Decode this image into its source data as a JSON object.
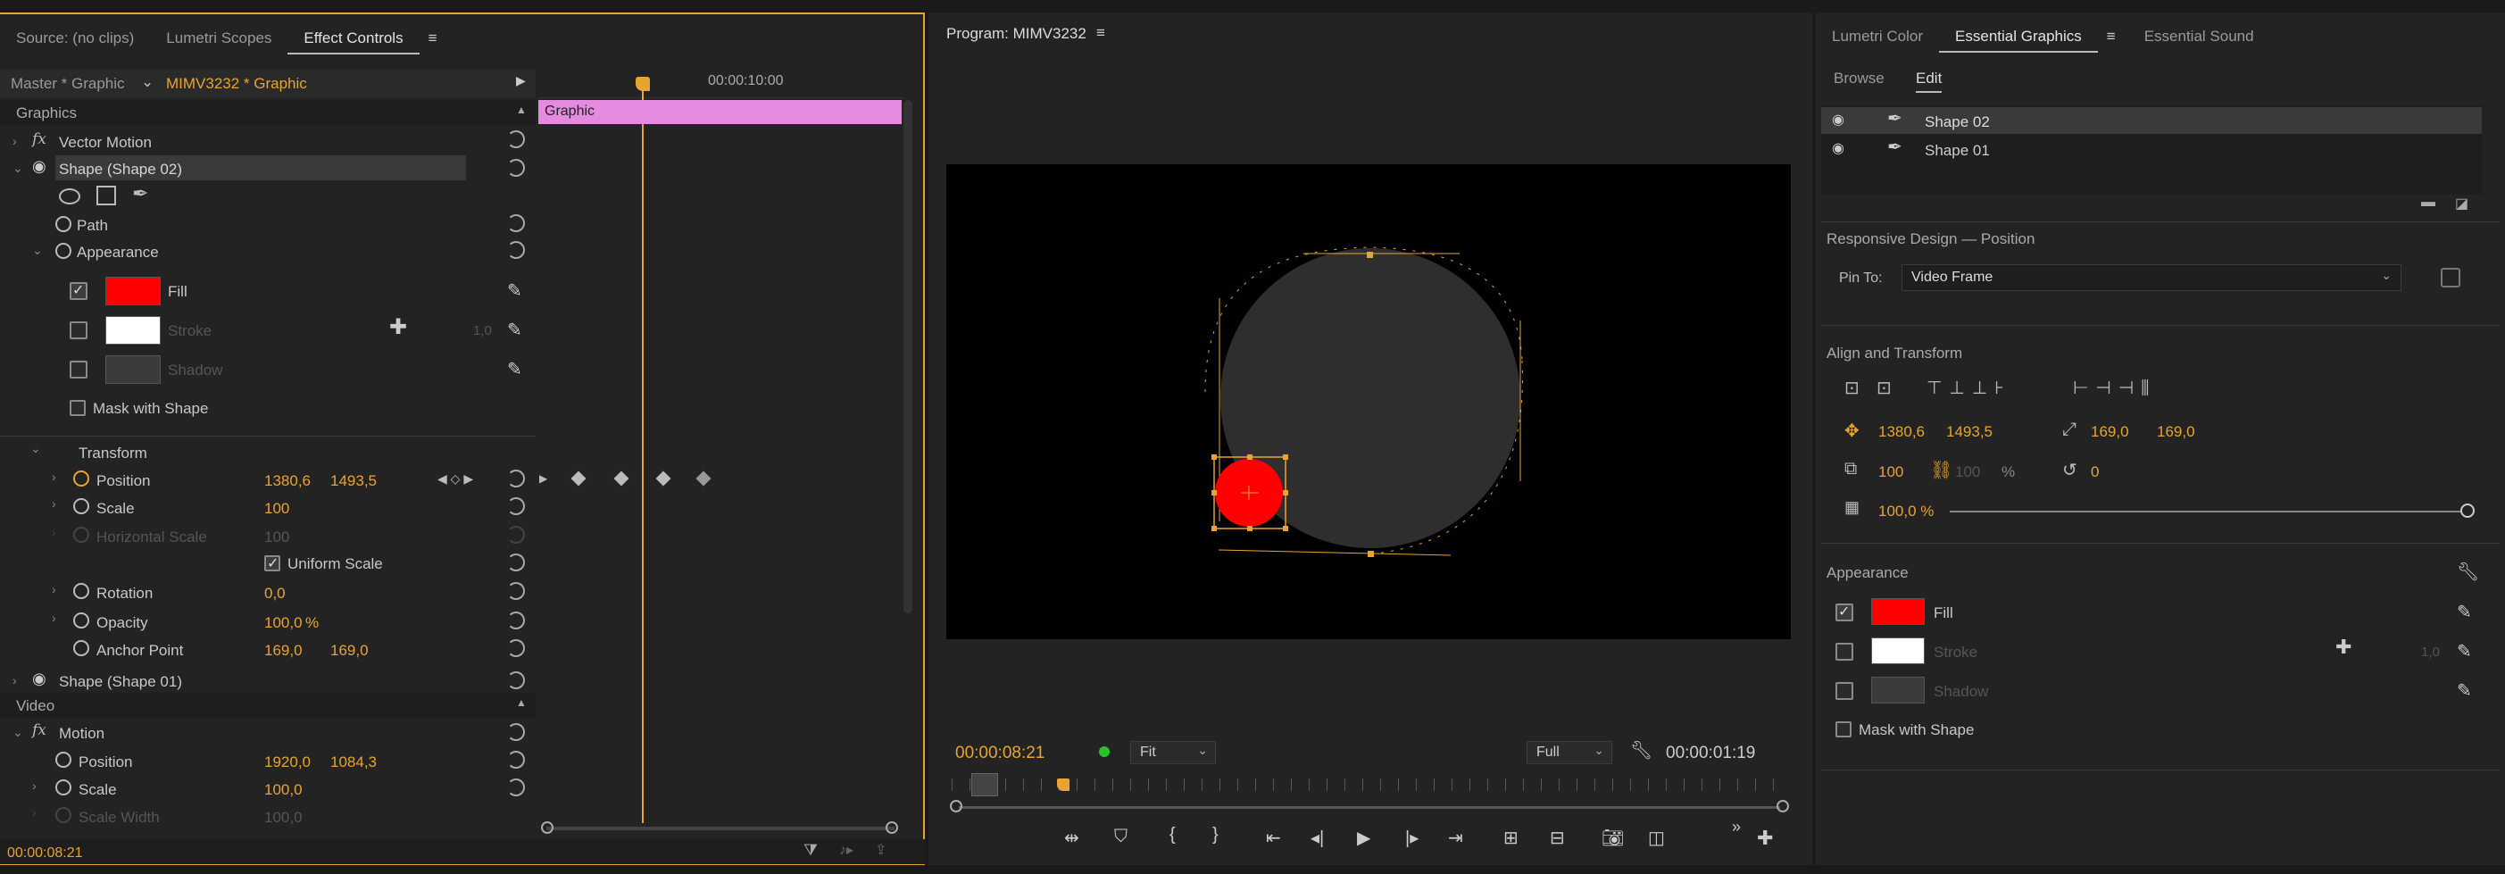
{
  "left_panel": {
    "tabs": [
      "Source: (no clips)",
      "Lumetri Scopes",
      "Effect Controls"
    ],
    "master_label": "Master * Graphic",
    "clip_label": "MIMV3232 * Graphic",
    "timecode_ruler": "00:00:10:00",
    "graphic_bar_label": "Graphic",
    "graphics_header": "Graphics",
    "vector_motion": "Vector Motion",
    "shape02": "Shape (Shape 02)",
    "path": "Path",
    "appearance": "Appearance",
    "fill": "Fill",
    "stroke": "Stroke",
    "stroke_width": "1,0",
    "shadow": "Shadow",
    "mask_with_shape": "Mask with Shape",
    "transform": "Transform",
    "position_label": "Position",
    "position_x": "1380,6",
    "position_y": "1493,5",
    "scale_label": "Scale",
    "scale_value": "100",
    "hscale_label": "Horizontal Scale",
    "hscale_value": "100",
    "uniform_scale": "Uniform Scale",
    "rotation_label": "Rotation",
    "rotation_value": "0,0",
    "opacity_label": "Opacity",
    "opacity_value": "100,0",
    "opacity_unit": "%",
    "anchor_label": "Anchor Point",
    "anchor_x": "169,0",
    "anchor_y": "169,0",
    "shape01": "Shape (Shape 01)",
    "video_header": "Video",
    "motion": "Motion",
    "motion_position_label": "Position",
    "motion_position_x": "1920,0",
    "motion_position_y": "1084,3",
    "motion_scale_label": "Scale",
    "motion_scale_value": "100,0",
    "scale_width_label": "Scale Width",
    "scale_width_value": "100,0",
    "footer_timecode": "00:00:08:21",
    "fill_color": "#ff0000",
    "stroke_color": "#ffffff"
  },
  "program_monitor": {
    "title": "Program: MIMV3232",
    "timecode": "00:00:08:21",
    "fit_option": "Fit",
    "quality_option": "Full",
    "duration": "00:00:01:19",
    "circle_color": "#2e2e2e",
    "small_circle_color": "#ff0000"
  },
  "right_panel": {
    "tabs": [
      "Lumetri Color",
      "Essential Graphics",
      "Essential Sound"
    ],
    "subtabs": [
      "Browse",
      "Edit"
    ],
    "layers": [
      "Shape 02",
      "Shape 01"
    ],
    "responsive_header": "Responsive Design — Position",
    "pin_to_label": "Pin To:",
    "pin_to_value": "Video Frame",
    "align_header": "Align and Transform",
    "pos_x": "1380,6",
    "pos_y": "1493,5",
    "anchor_x": "169,0",
    "anchor_y": "169,0",
    "scale": "100",
    "scale_locked": "100",
    "scale_unit": "%",
    "rotation": "0",
    "opacity": "100,0 %",
    "opacity_level": 1.0,
    "appearance_header": "Appearance",
    "fill": "Fill",
    "stroke": "Stroke",
    "stroke_width": "1,0",
    "shadow": "Shadow",
    "mask_with_shape": "Mask with Shape"
  }
}
